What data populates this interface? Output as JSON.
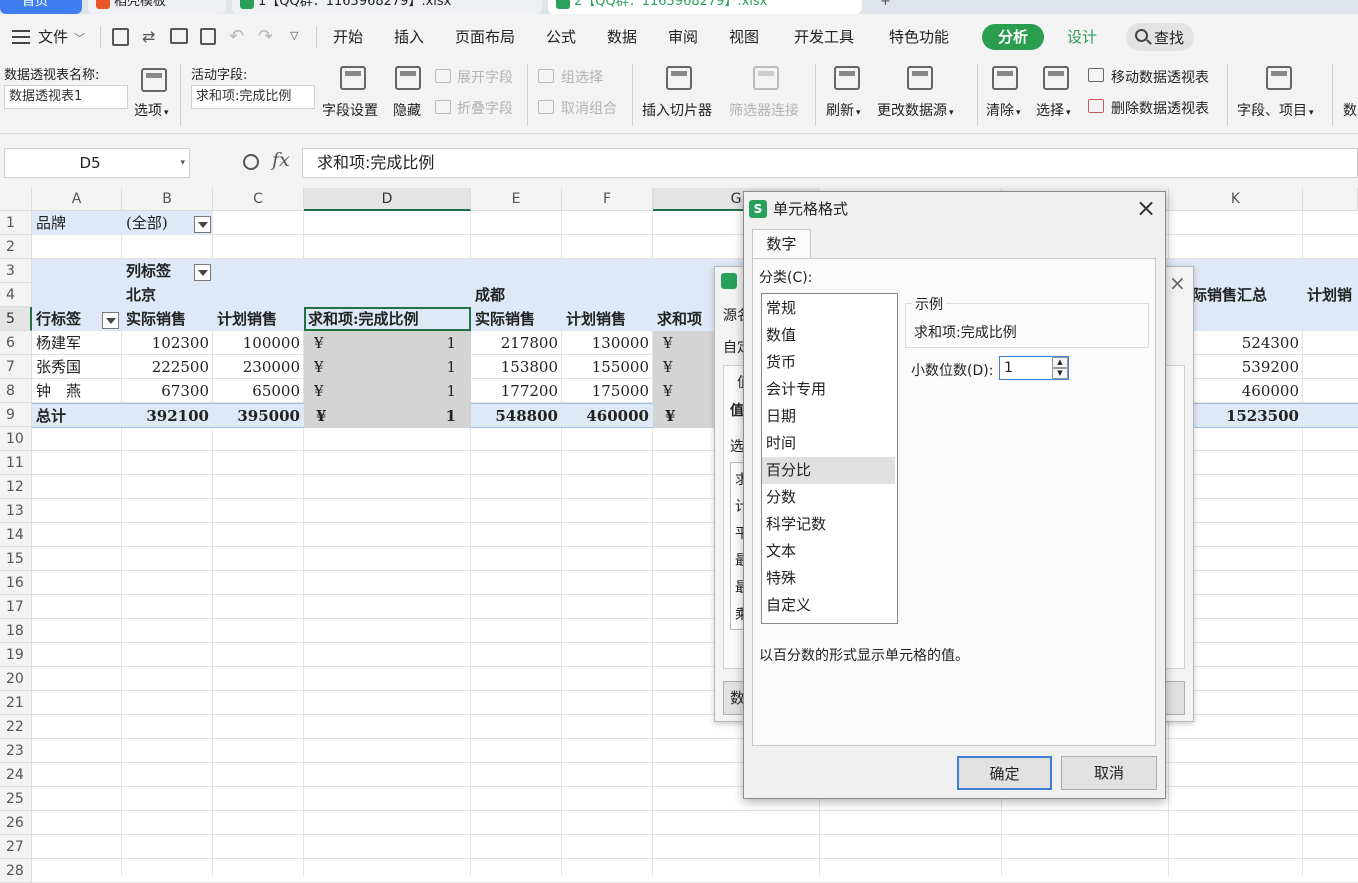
{
  "tabs": [
    {
      "label": "首页",
      "color": "#ffffff"
    },
    {
      "label": "稻壳模板",
      "color": "#e8562a"
    },
    {
      "label": "1【QQ群：1163968279】.xlsx",
      "color": "#2aa15b"
    },
    {
      "label": "2【QQ群：1163968279】.xlsx",
      "color": "#2aa15b"
    }
  ],
  "tab_plus": "+",
  "menubar": {
    "file": "文件",
    "items": [
      "开始",
      "插入",
      "页面布局",
      "公式",
      "数据",
      "审阅",
      "视图",
      "开发工具",
      "特色功能"
    ],
    "analyze": "分析",
    "design": "设计",
    "search": "查找"
  },
  "ribbon": {
    "pivot_name_label": "数据透视表名称:",
    "pivot_name_value": "数据透视表1",
    "options": "选项",
    "active_field_label": "活动字段:",
    "active_field_value": "求和项:完成比例",
    "field_settings": "字段设置",
    "hide": "隐藏",
    "expand_field": "展开字段",
    "collapse_field": "折叠字段",
    "group_selection": "组选择",
    "ungroup": "取消组合",
    "insert_slicer": "插入切片器",
    "filter_connection": "筛选器连接",
    "refresh": "刷新",
    "change_source": "更改数据源",
    "clear": "清除",
    "select": "选择",
    "move_pivot": "移动数据透视表",
    "delete_pivot": "删除数据透视表",
    "fields_items": "字段、项目",
    "more": "数"
  },
  "formula": {
    "name_box": "D5",
    "fx": "fx",
    "content": "求和项:完成比例"
  },
  "grid": {
    "columns": [
      "A",
      "B",
      "C",
      "D",
      "E",
      "F",
      "G",
      "K"
    ],
    "rows": [
      "1",
      "2",
      "3",
      "4",
      "5",
      "6",
      "7",
      "8",
      "9",
      "10",
      "11",
      "12",
      "13",
      "14",
      "15",
      "16",
      "17",
      "18",
      "19",
      "20",
      "21",
      "22",
      "23",
      "24",
      "25",
      "26",
      "27",
      "28"
    ],
    "r1": {
      "a": "品牌",
      "b": "(全部)"
    },
    "r3": {
      "b": "列标签"
    },
    "r4": {
      "b": "北京",
      "e": "成都",
      "k": "际销售汇总",
      "l": "计划销"
    },
    "r5": {
      "a": "行标签",
      "b": "实际销售",
      "c": "计划销售",
      "d": "求和项:完成比例",
      "e": "实际销售",
      "f": "计划销售",
      "g": "求和项"
    },
    "data": [
      {
        "a": "杨建军",
        "b": "102300",
        "c": "100000",
        "dsym": "¥",
        "d": "1",
        "e": "217800",
        "f": "130000",
        "gsym": "¥",
        "k": "524300"
      },
      {
        "a": "张秀国",
        "b": "222500",
        "c": "230000",
        "dsym": "¥",
        "d": "1",
        "e": "153800",
        "f": "155000",
        "gsym": "¥",
        "k": "539200"
      },
      {
        "a": "钟　燕",
        "b": "67300",
        "c": "65000",
        "dsym": "¥",
        "d": "1",
        "e": "177200",
        "f": "175000",
        "gsym": "¥",
        "k": "460000"
      }
    ],
    "total": {
      "a": "总计",
      "b": "392100",
      "c": "395000",
      "dsym": "¥",
      "d": "1",
      "e": "548800",
      "f": "460000",
      "gsym": "¥",
      "k": "1523500"
    }
  },
  "back_dialog": {
    "t1": "源名",
    "t2": "自定",
    "tab": "值",
    "section": "值",
    "label_sel": "选",
    "items": [
      "求",
      "计",
      "平",
      "最",
      "最",
      "乘"
    ],
    "bottom_btn": "数"
  },
  "dialog": {
    "title": "单元格格式",
    "tab": "数字",
    "category_label": "分类(C):",
    "categories": [
      "常规",
      "数值",
      "货币",
      "会计专用",
      "日期",
      "时间",
      "百分比",
      "分数",
      "科学记数",
      "文本",
      "特殊",
      "自定义"
    ],
    "sample_label": "示例",
    "sample_value": "求和项:完成比例",
    "decimal_label": "小数位数(D):",
    "decimal_value": "1",
    "description": "以百分数的形式显示单元格的值。",
    "ok": "确定",
    "cancel": "取消"
  }
}
